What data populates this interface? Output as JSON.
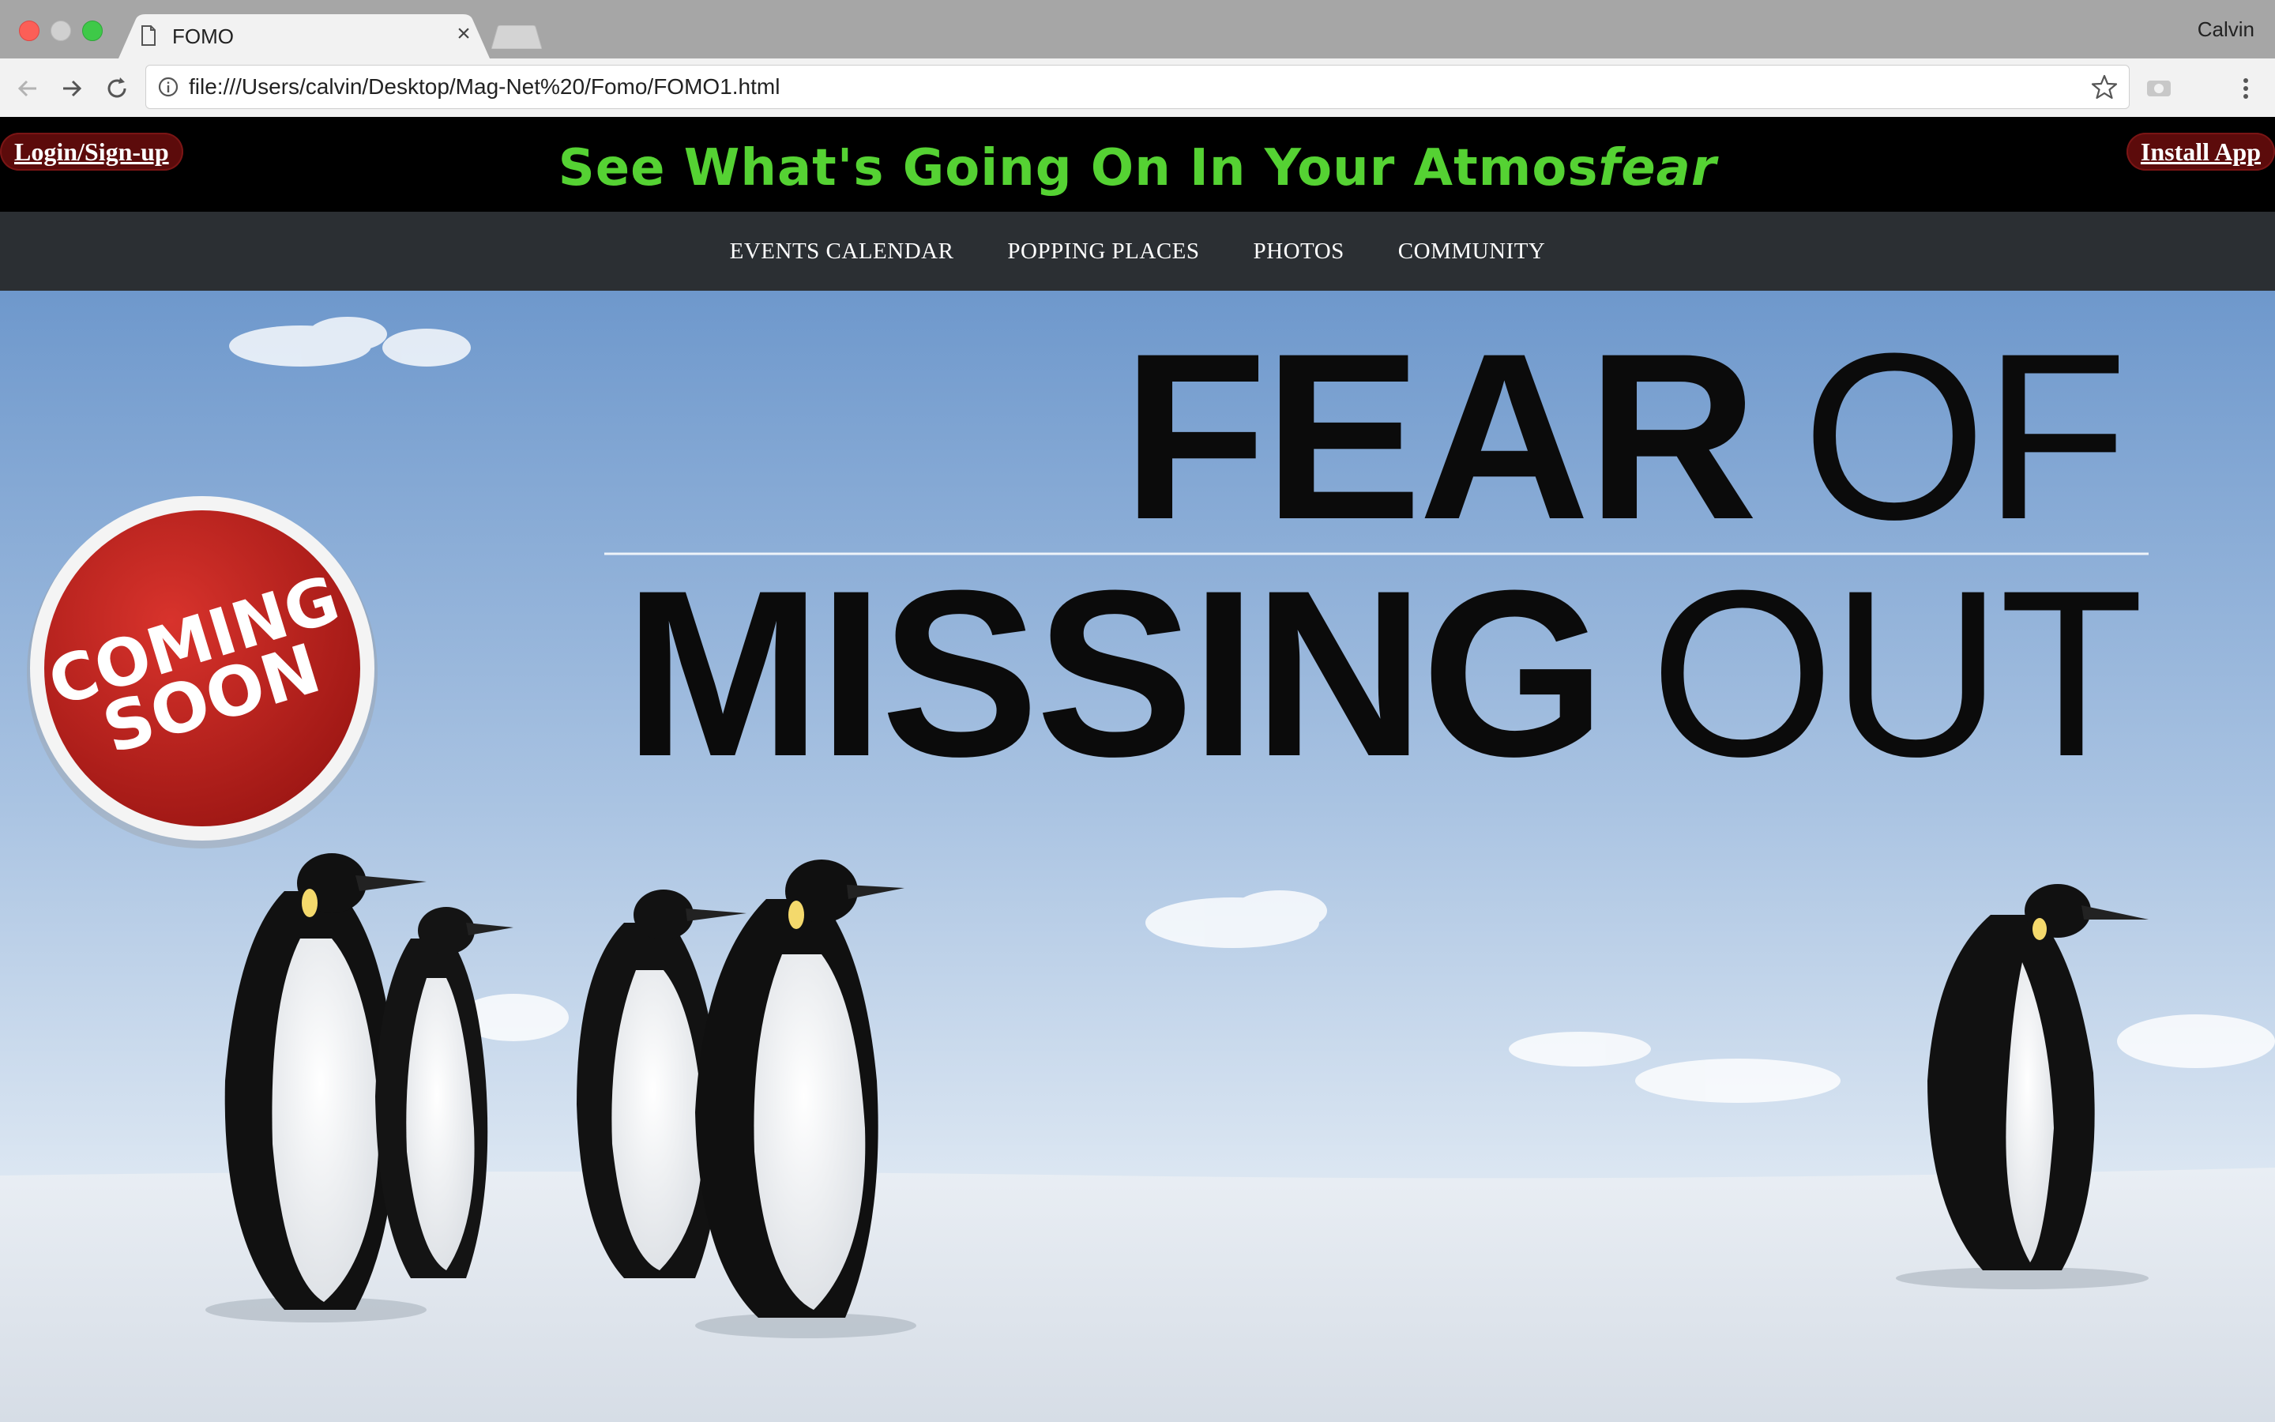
{
  "browser": {
    "tab_title": "FOMO",
    "tab_close": "×",
    "profile_name": "Calvin",
    "url": "file:///Users/calvin/Desktop/Mag-Net%20/Fomo/FOMO1.html"
  },
  "header": {
    "login_label": "Login/Sign-up",
    "install_label": "Install App",
    "tagline_main": "See What's Going On In Your Atmos",
    "tagline_accent": "fear",
    "tagline_color": "#55d233"
  },
  "nav": {
    "items": [
      {
        "label": "EVENTS CALENDAR"
      },
      {
        "label": "POPPING PLACES"
      },
      {
        "label": "PHOTOS"
      },
      {
        "label": "COMMUNITY"
      }
    ]
  },
  "hero": {
    "headline_word1": "FEAR",
    "headline_word2": "OF",
    "headline_word3": "MISSING",
    "headline_word4": "OUT",
    "badge_line1": "COMING",
    "badge_line2": "SOON"
  }
}
